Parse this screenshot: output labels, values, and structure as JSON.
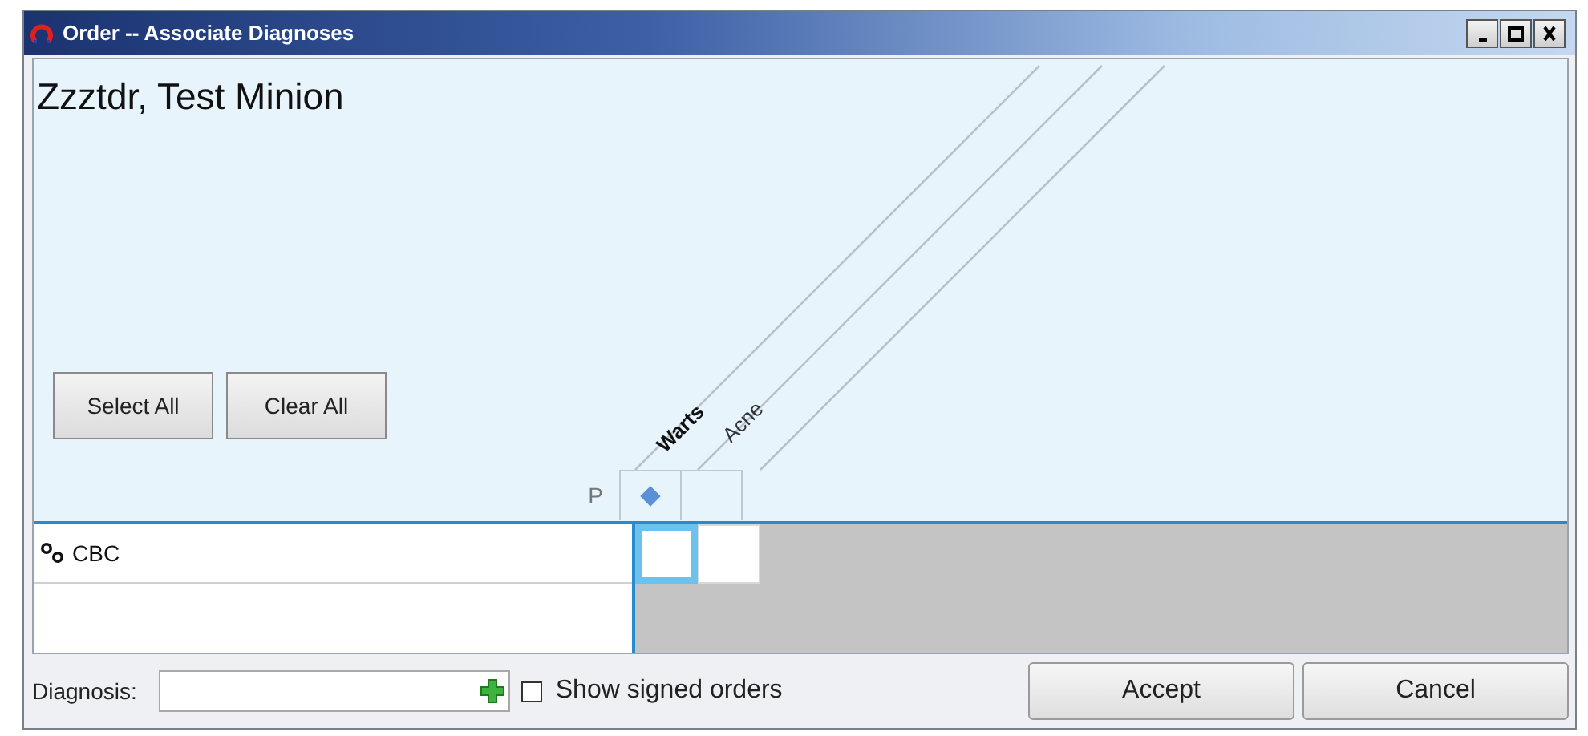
{
  "window": {
    "title": "Order -- Associate Diagnoses"
  },
  "patient_name": "Zzztdr, Test Minion",
  "header_buttons": [
    {
      "label": "Select All"
    },
    {
      "label": "Clear All"
    }
  ],
  "priority_label": "P",
  "diagnoses": [
    {
      "name": "Warts",
      "primary": true
    },
    {
      "name": "Acne",
      "primary": false
    }
  ],
  "orders": [
    {
      "name": "CBC",
      "cells": [
        {
          "checked": false,
          "selected": true
        },
        {
          "checked": false,
          "selected": false
        }
      ]
    }
  ],
  "diagnosis_field": {
    "label": "Diagnosis:"
  },
  "show_signed": {
    "label": "Show signed orders",
    "checked": false
  },
  "buttons": [
    {
      "label": "Accept"
    },
    {
      "label": "Cancel"
    }
  ]
}
